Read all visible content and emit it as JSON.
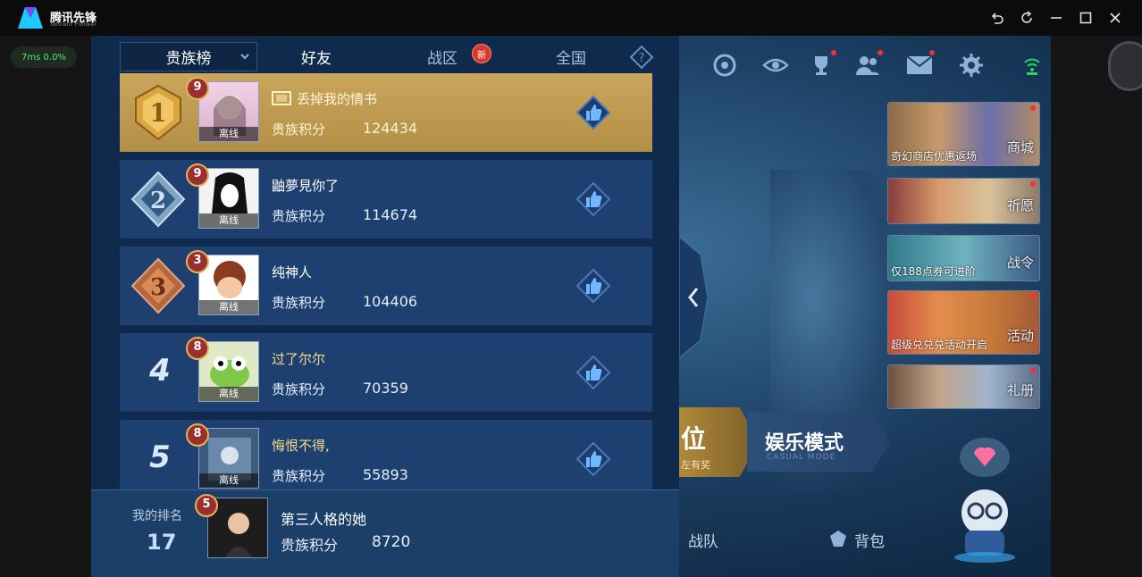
{
  "emulator": {
    "brand_name": "腾讯先锋",
    "brand_sub": "Tencent Pioneer",
    "fps": "7ms  0.0%"
  },
  "tabs": {
    "dropdown": "贵族榜",
    "friends": "好友",
    "zone": "战区",
    "zone_badge": "新",
    "national": "全国"
  },
  "leaderboard": [
    {
      "rank": "1",
      "vip": "9",
      "name": "丢掉我的情书",
      "status": "离线",
      "label": "贵族积分",
      "score": "124434"
    },
    {
      "rank": "2",
      "vip": "9",
      "name": "鼬夢見你了",
      "status": "离线",
      "label": "贵族积分",
      "score": "114674"
    },
    {
      "rank": "3",
      "vip": "3",
      "name": "纯神人",
      "status": "离线",
      "label": "贵族积分",
      "score": "104406"
    },
    {
      "rank": "4",
      "vip": "8",
      "name": "过了尔尔",
      "status": "离线",
      "label": "贵族积分",
      "score": "70359"
    },
    {
      "rank": "5",
      "vip": "8",
      "name": "悔恨不得,",
      "status": "离线",
      "label": "贵族积分",
      "score": "55893"
    }
  ],
  "my_rank": {
    "label": "我的排名",
    "rank": "17",
    "vip": "5",
    "name": "第三人格的她",
    "score_label": "贵族积分",
    "score": "8720"
  },
  "promos": [
    {
      "caption": "奇幻商店优惠返场",
      "tag": "商城"
    },
    {
      "caption": "",
      "tag": "祈愿"
    },
    {
      "caption": "仅188点券可进阶",
      "tag": "战令"
    },
    {
      "caption": "超级兑兑兑活动开启",
      "tag": "活动"
    },
    {
      "caption": "",
      "tag": "礼册"
    }
  ],
  "modes": {
    "rank_main": "位",
    "rank_sub": "左有奖",
    "casual": "娱乐模式",
    "casual_sub": "CASUAL MODE"
  },
  "bottom_nav": {
    "team": "战队",
    "bag": "背包"
  },
  "colors": {
    "accent_gold": "#c9a65b",
    "panel": "#0f2a4c",
    "row": "#1e4070"
  }
}
